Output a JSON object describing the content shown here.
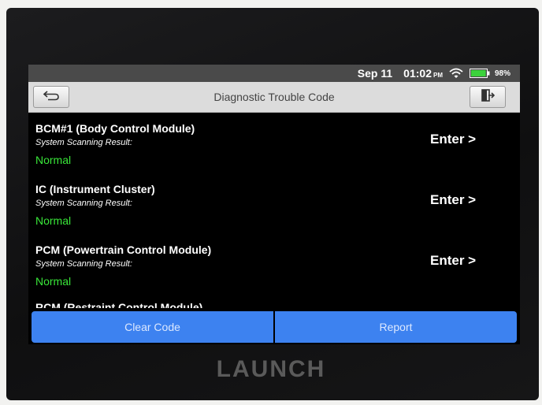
{
  "status": {
    "date": "Sep 11",
    "time": "01:02",
    "ampm": "PM",
    "battery": "98%",
    "battery_level": 0.98
  },
  "header": {
    "title": "Diagnostic Trouble Code"
  },
  "modules": [
    {
      "name": "BCM#1 (Body Control Module)",
      "subtitle": "System Scanning Result:",
      "result": "Normal",
      "action": "Enter >"
    },
    {
      "name": "IC (Instrument Cluster)",
      "subtitle": "System Scanning Result:",
      "result": "Normal",
      "action": "Enter >"
    },
    {
      "name": "PCM (Powertrain Control Module)",
      "subtitle": "System Scanning Result:",
      "result": "Normal",
      "action": "Enter >"
    },
    {
      "name": "RCM (Restraint Control Module)"
    }
  ],
  "actions": {
    "clear": "Clear Code",
    "report": "Report"
  },
  "device": {
    "brand": "LAUNCH"
  },
  "colors": {
    "accent": "#3d82f0",
    "normal_status": "#39e639",
    "battery": "#3cd23c"
  }
}
